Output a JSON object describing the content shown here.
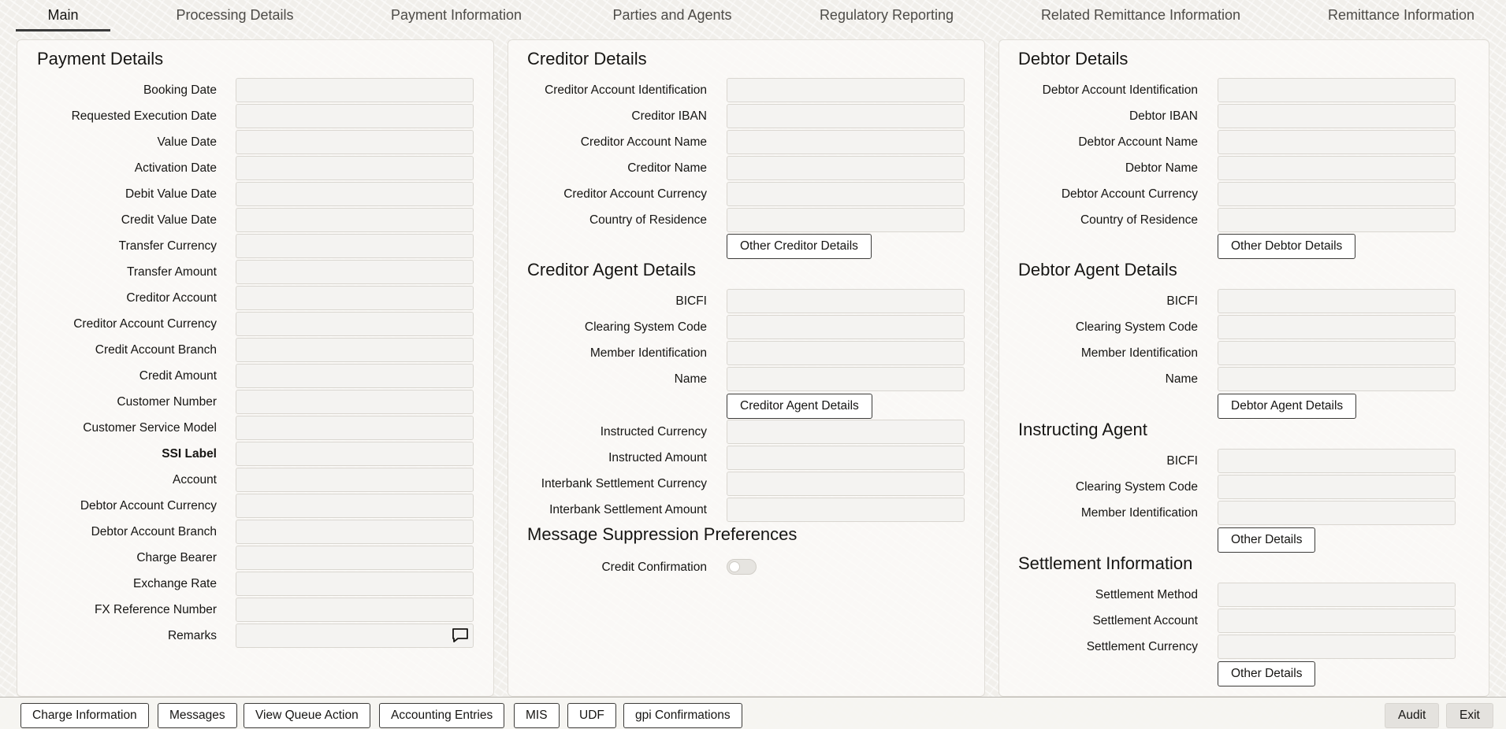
{
  "tabs": [
    {
      "label": "Main",
      "active": true
    },
    {
      "label": "Processing Details"
    },
    {
      "label": "Payment Information"
    },
    {
      "label": "Parties and Agents"
    },
    {
      "label": "Regulatory Reporting"
    },
    {
      "label": "Related Remittance Information"
    },
    {
      "label": "Remittance Information"
    }
  ],
  "payment_details": {
    "title": "Payment Details",
    "fields": [
      {
        "label": "Booking Date",
        "value": ""
      },
      {
        "label": "Requested Execution Date",
        "value": ""
      },
      {
        "label": "Value Date",
        "value": ""
      },
      {
        "label": "Activation Date",
        "value": ""
      },
      {
        "label": "Debit Value Date",
        "value": ""
      },
      {
        "label": "Credit Value Date",
        "value": ""
      },
      {
        "label": "Transfer Currency",
        "value": ""
      },
      {
        "label": "Transfer Amount",
        "value": ""
      },
      {
        "label": "Creditor Account",
        "value": ""
      },
      {
        "label": "Creditor Account Currency",
        "value": ""
      },
      {
        "label": "Credit Account Branch",
        "value": ""
      },
      {
        "label": "Credit Amount",
        "value": ""
      },
      {
        "label": "Customer Number",
        "value": ""
      },
      {
        "label": "Customer Service Model",
        "value": ""
      },
      {
        "label": "SSI Label",
        "value": ""
      },
      {
        "label": "Account",
        "value": ""
      },
      {
        "label": "Debtor Account Currency",
        "value": ""
      },
      {
        "label": "Debtor Account Branch",
        "value": ""
      },
      {
        "label": "Charge Bearer",
        "value": ""
      },
      {
        "label": "Exchange Rate",
        "value": ""
      },
      {
        "label": "FX Reference Number",
        "value": ""
      },
      {
        "label": "Remarks",
        "value": ""
      }
    ],
    "remarks_icon": "comment-icon"
  },
  "creditor_details": {
    "title": "Creditor Details",
    "fields": [
      {
        "label": "Creditor Account Identification",
        "value": ""
      },
      {
        "label": "Creditor IBAN",
        "value": ""
      },
      {
        "label": "Creditor Account Name",
        "value": ""
      },
      {
        "label": "Creditor Name",
        "value": ""
      },
      {
        "label": "Creditor Account Currency",
        "value": ""
      },
      {
        "label": "Country of Residence",
        "value": ""
      }
    ],
    "button": "Other Creditor Details"
  },
  "creditor_agent_details": {
    "title": "Creditor Agent Details",
    "fields": [
      {
        "label": "BICFI",
        "value": ""
      },
      {
        "label": "Clearing System Code",
        "value": ""
      },
      {
        "label": "Member Identification",
        "value": ""
      },
      {
        "label": "Name",
        "value": ""
      }
    ],
    "button": "Creditor Agent Details",
    "extra_fields": [
      {
        "label": "Instructed Currency",
        "value": ""
      },
      {
        "label": "Instructed Amount",
        "value": ""
      },
      {
        "label": "Interbank Settlement Currency",
        "value": ""
      },
      {
        "label": "Interbank Settlement Amount",
        "value": ""
      }
    ]
  },
  "message_suppression": {
    "title": "Message Suppression Preferences",
    "toggle_label": "Credit Confirmation",
    "toggle_on": false
  },
  "debtor_details": {
    "title": "Debtor Details",
    "fields": [
      {
        "label": "Debtor Account Identification",
        "value": ""
      },
      {
        "label": "Debtor IBAN",
        "value": ""
      },
      {
        "label": "Debtor Account Name",
        "value": ""
      },
      {
        "label": "Debtor Name",
        "value": ""
      },
      {
        "label": "Debtor Account Currency",
        "value": ""
      },
      {
        "label": "Country of Residence",
        "value": ""
      }
    ],
    "button": "Other Debtor Details"
  },
  "debtor_agent_details": {
    "title": "Debtor Agent Details",
    "fields": [
      {
        "label": "BICFI",
        "value": ""
      },
      {
        "label": "Clearing System Code",
        "value": ""
      },
      {
        "label": "Member Identification",
        "value": ""
      },
      {
        "label": "Name",
        "value": ""
      }
    ],
    "button": "Debtor Agent Details"
  },
  "instructing_agent": {
    "title": "Instructing Agent",
    "fields": [
      {
        "label": "BICFI",
        "value": ""
      },
      {
        "label": "Clearing System Code",
        "value": ""
      },
      {
        "label": "Member Identification",
        "value": ""
      }
    ],
    "button": "Other Details"
  },
  "settlement_information": {
    "title": "Settlement Information",
    "fields": [
      {
        "label": "Settlement Method",
        "value": ""
      },
      {
        "label": "Settlement Account",
        "value": ""
      },
      {
        "label": "Settlement Currency",
        "value": ""
      }
    ],
    "button": "Other Details"
  },
  "bottom_bar": {
    "buttons": [
      "Charge Information",
      "Messages",
      "View Queue Action",
      "Accounting Entries",
      "MIS",
      "UDF",
      "gpi Confirmations"
    ],
    "audit": "Audit",
    "exit": "Exit"
  }
}
